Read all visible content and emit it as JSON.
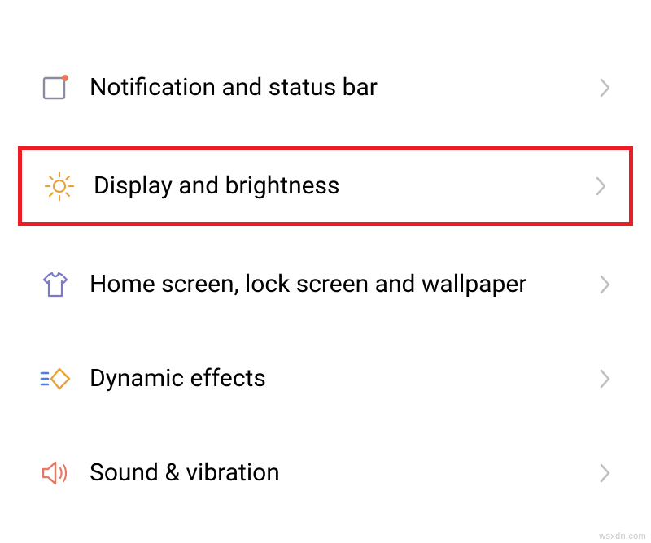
{
  "settings": {
    "items": [
      {
        "label": "Notification and status bar"
      },
      {
        "label": "Display and brightness"
      },
      {
        "label": "Home screen, lock screen and wallpaper"
      },
      {
        "label": "Dynamic effects"
      },
      {
        "label": "Sound & vibration"
      }
    ]
  },
  "watermark": "wsxdn.com"
}
